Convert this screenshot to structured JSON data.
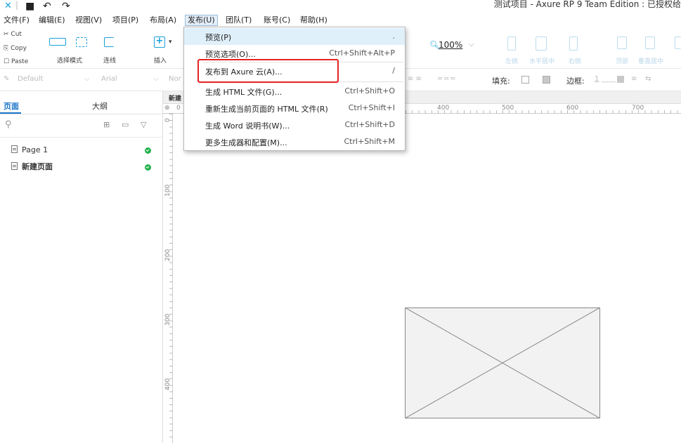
{
  "window": {
    "title": "测试项目 - Axure RP 9 Team Edition : 已授权给"
  },
  "menubar": [
    {
      "label": "文件(F)"
    },
    {
      "label": "编辑(E)"
    },
    {
      "label": "视图(V)"
    },
    {
      "label": "项目(P)"
    },
    {
      "label": "布局(A)"
    },
    {
      "label": "发布(U)"
    },
    {
      "label": "团队(T)"
    },
    {
      "label": "账号(C)"
    },
    {
      "label": "帮助(H)"
    }
  ],
  "toolbar": {
    "cut": "Cut",
    "copy": "Copy",
    "paste": "Paste",
    "select_mode": "选择模式",
    "connect": "连线",
    "insert": "插入",
    "zoom": "100%",
    "align_left": "左侧",
    "align_center": "水平居中",
    "align_right": "右侧",
    "align_top": "顶部",
    "align_middle": "垂直居中"
  },
  "stylebar": {
    "style": "Default",
    "font": "Arial",
    "style2": "Nor",
    "fill_label": "填充:",
    "border_label": "边框:",
    "border_value": "1"
  },
  "left_panel": {
    "tabs": [
      "页面",
      "大纲"
    ],
    "pages": [
      "Page 1",
      "新建页面"
    ]
  },
  "canvas": {
    "tab_label": "新建",
    "ruler_origin": "0",
    "ruler_h": [
      "400",
      "500",
      "600",
      "700"
    ],
    "ruler_v": [
      "0",
      "100",
      "200",
      "300",
      "400"
    ]
  },
  "publish_menu": {
    "items": [
      {
        "label": "预览(P)",
        "shortcut": "."
      },
      {
        "label": "预览选项(O)...",
        "shortcut": "Ctrl+Shift+Alt+P"
      },
      {
        "label": "发布到 Axure 云(A)...",
        "shortcut": "/"
      },
      {
        "label": "生成 HTML 文件(G)...",
        "shortcut": "Ctrl+Shift+O"
      },
      {
        "label": "重新生成当前页面的 HTML 文件(R)",
        "shortcut": "Ctrl+Shift+I"
      },
      {
        "label": "生成 Word 说明书(W)...",
        "shortcut": "Ctrl+Shift+D"
      },
      {
        "label": "更多生成器和配置(M)...",
        "shortcut": "Ctrl+Shift+M"
      }
    ]
  }
}
